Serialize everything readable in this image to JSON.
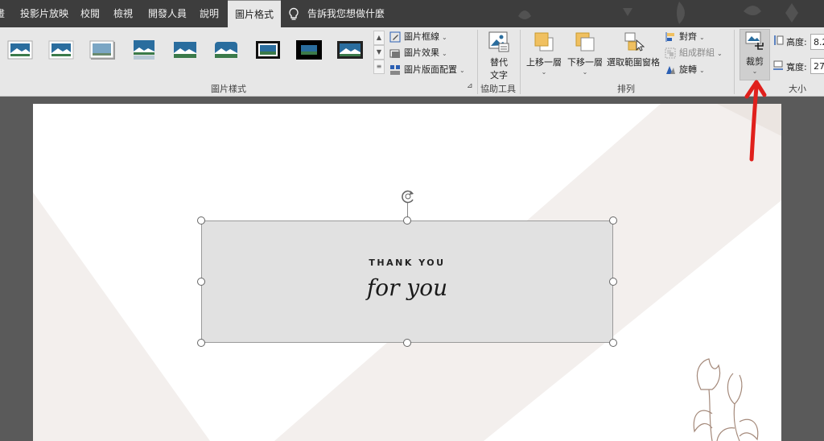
{
  "tabs": [
    {
      "label": "畫"
    },
    {
      "label": "投影片放映"
    },
    {
      "label": "校閱"
    },
    {
      "label": "檢視"
    },
    {
      "label": "開發人員"
    },
    {
      "label": "說明"
    },
    {
      "label": "圖片格式",
      "active": true
    }
  ],
  "tellme": "告訴我您想做什麼",
  "ribbon": {
    "picture_styles": {
      "label": "圖片樣式",
      "border": "圖片框線",
      "effects": "圖片效果",
      "layout": "圖片版面配置"
    },
    "accessibility": {
      "label": "協助工具",
      "alt_text_line1": "替代",
      "alt_text_line2": "文字"
    },
    "arrange": {
      "label": "排列",
      "bring_forward": "上移一層",
      "send_backward": "下移一層",
      "selection_pane": "選取範圍窗格",
      "align": "對齊",
      "group": "組成群組",
      "rotate": "旋轉"
    },
    "size": {
      "label": "大小",
      "crop": "裁剪",
      "height_label": "高度:",
      "height_value": "8.2",
      "width_label": "寬度:",
      "width_value": "27.",
      "launcher": "⊿"
    }
  },
  "slide": {
    "card_title": "THANK YOU",
    "card_script": "for you"
  },
  "colors": {
    "annotation_arrow": "#e0201c",
    "tabbar": "#3d3d3d",
    "ribbon": "#e7e7e7",
    "card": "#e1e1e1"
  }
}
